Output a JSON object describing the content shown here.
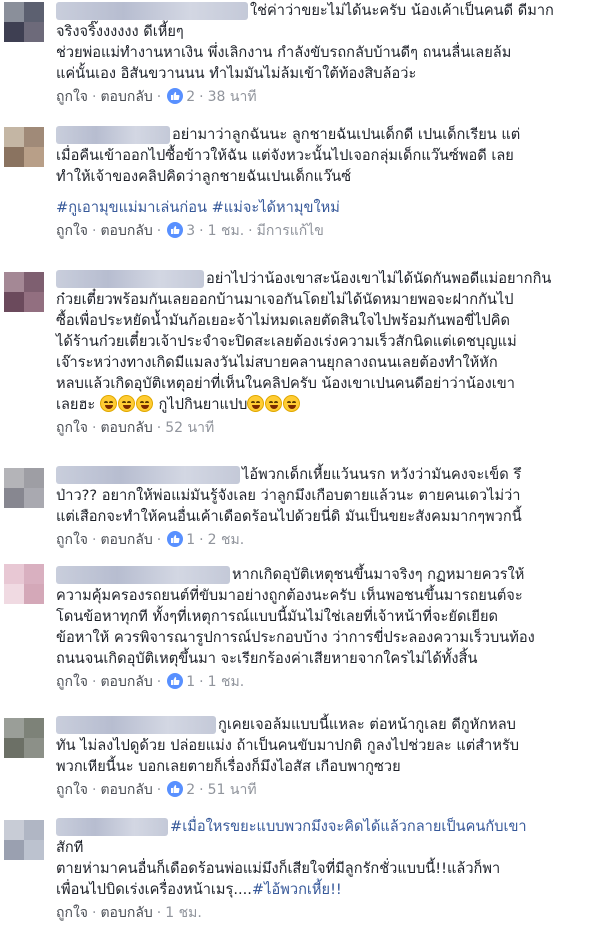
{
  "comments": [
    {
      "lines": [
        "ใช่ค่าว่าขยะไม่ได้นะครับ น้องเค้าเป็นคนดี ดีมาก",
        "จริงจริ๊งงงงงง ดีเหี้ยๆ",
        "ช่วยพ่อแม่ทำงานหาเงิน พึ่งเลิกงาน กำลังขับรถกลับบ้านดีๆ ถนนลื่นเลยล้ม",
        "แค่นั้นเอง อิสันขวานนน ทำไมมันไม่ล้มเข้าใต้ท้องสิบล้อว่ะ"
      ],
      "actions": {
        "like": "ถูกใจ",
        "reply": "ตอบกลับ",
        "likes": "2",
        "time": "38 นาที"
      }
    },
    {
      "lines": [
        "อย่ามาว่าลูกฉันนะ ลูกชายฉันเปนเด็กดี เปนเด็กเรียน แต่",
        "เมื่อคืนเข้าออกไปซื้อข้าวให้ฉัน แต่จังหวะนั้นไปเจอกลุ่มเด็กแว๊นซ์พอดี เลย",
        "ทำให้เจ้าของคลิปคิดว่าลูกชายฉันเปนเด็กแว๊นซ์"
      ],
      "hashtags": [
        "#กูเอามุขแม่มาเล่นก่อน",
        "#แม่จะได้หามุขใหม่"
      ],
      "actions": {
        "like": "ถูกใจ",
        "reply": "ตอบกลับ",
        "likes": "3",
        "time": "1 ชม.",
        "edited": "มีการแก้ไข"
      }
    },
    {
      "lines": [
        "อย่าไปว่าน้องเขาสะน้องเขาไม่ได้นัดกันพอดีแม่อยากกิน",
        "ก๋วยเตี๋ยวพร้อมกันเลยออกบ้านมาเจอกันโดยไม่ได้นัดหมายพอจะฝากกันไป",
        "ซื้อเพื่อประหยัดน้ำมันก้อเยอะจ้าไม่หมดเลยตัดสินใจไปพร้อมกันพอขี่ไปคิด",
        "ได้ร้านก๋วยเตี๋ยวเจ้าประจำจะปิดสะเลยต้องเร่งความเร็วสักนิดแต่เดชบุญแม่",
        "เจ๊าระหว่างทางเกิดมีแมลงวันไม่สบายคลานยุกลางถนนเลยต้องทำให้หัก",
        "หลบแล้วเกิดอุบัติเหตุอย่าที่เห็นในคลิปครับ น้องเขาเปนคนดีอย่าว่าน้องเขา",
        "เลยฮะ",
        "กูไปกินยาแปบ"
      ],
      "actions": {
        "like": "ถูกใจ",
        "reply": "ตอบกลับ",
        "time": "52 นาที"
      }
    },
    {
      "lines": [
        "ไอ้พวกเด็กเหี้ยแว้นนรก หวังว่ามันคงจะเข็ด รึ",
        "ป่าว?? อยากให้พ่อแม่มันรู้จังเลย ว่าลูกมึงเกือบตายแล้วนะ ตายคนเดวไม่ว่า",
        "แต่เสือกจะทำให้คนอื่นเค้าเดือดร้อนไปด้วยนี่ดิ มันเป็นขยะสังคมมากๆพวกนี้"
      ],
      "actions": {
        "like": "ถูกใจ",
        "reply": "ตอบกลับ",
        "likes": "1",
        "time": "2 ชม."
      }
    },
    {
      "lines": [
        "หากเกิดอุบัติเหตุชนขึ้นมาจริงๆ กฏหมายควรให้",
        "ความคุ้มครองรถยนต์ที่ขับมาอย่างถูกต้องนะครับ เห็นพอชนขึ้นมารถยนต์จะ",
        "โดนข้อหาทุกที ทั้งๆที่เหตุการณ์แบบนี้มันไม่ใช่เลยที่เจ้าหน้าที่จะยัดเยียด",
        "ข้อหาให้ ควรพิจารณารูปการณ์ประกอบบ้าง ว่าการขี่ประลองความเร็วบนท้อง",
        "ถนนจนเกิดอุบัติเหตุขึ้นมา จะเรียกร้องค่าเสียหายจากใครไม่ได้ทั้งสิ้น"
      ],
      "actions": {
        "like": "ถูกใจ",
        "reply": "ตอบกลับ",
        "likes": "1",
        "time": "1 ชม."
      }
    },
    {
      "lines": [
        "กูเคยเจอล้มแบบนี้แหละ ต่อหน้ากูเลย ดีกูหักหลบ",
        "ทัน ไม่ลงไปดูด้วย ปล่อยแม่ง ถ้าเป็นคนขับมาปกติ กูลงไปช่วยละ แต่สำหรับ",
        "พวกเหียนี้นะ บอกเลยตายก็เรื่องก็มึงไอสัส เกือบพากูซวย"
      ],
      "actions": {
        "like": "ถูกใจ",
        "reply": "ตอบกลับ",
        "likes": "2",
        "time": "51 นาที"
      }
    },
    {
      "lines": [
        "#เมื่อใหรขยะแบบพวกมึงจะคิดได้แล้วกลายเป็นคนกับเขา",
        "สักที",
        "ตายห่ามาคนอื่นก็เดือดร้อนพ่อแม่มึงก็เสียใจที่มีลูกรักชั่วแบบนี้!!แล้วก็พา",
        "เพื่อนไปบิดเร่งเครื่องหน้าเมรุ....",
        "#ไอ้พวกเหี้ย!!"
      ],
      "actions": {
        "like": "ถูกใจ",
        "reply": "ตอบกลับ",
        "time": "1 ชม."
      }
    }
  ]
}
